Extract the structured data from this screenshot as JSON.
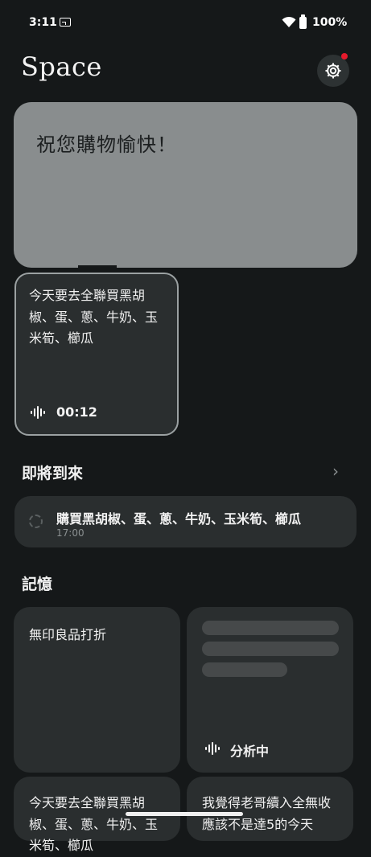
{
  "status_bar": {
    "time": "3:11",
    "battery": "100%"
  },
  "app": {
    "title": "Space"
  },
  "bubble": {
    "text": "祝您購物愉快！"
  },
  "voice_note": {
    "text": "今天要去全聯買黑胡椒、蛋、蔥、牛奶、玉米筍、櫛瓜",
    "duration": "00:12"
  },
  "upcoming": {
    "title": "即將到來",
    "chevron": "›",
    "task": {
      "text": "購買黑胡椒、蛋、蔥、牛奶、玉米筍、櫛瓜",
      "time": "17:00"
    }
  },
  "memories": {
    "title": "記憶",
    "cards": [
      {
        "text": "無印良品打折"
      },
      {
        "status": "分析中"
      },
      {
        "text": "今天要去全聯買黑胡椒、蛋、蔥、牛奶、玉米筍、櫛瓜"
      },
      {
        "text": "我覺得老哥續入全無收應該不是達5的今天"
      }
    ]
  },
  "colors": {
    "accent_dot": "#e41a2c",
    "bubble": "#898d8e",
    "card": "#2a2e2f"
  }
}
